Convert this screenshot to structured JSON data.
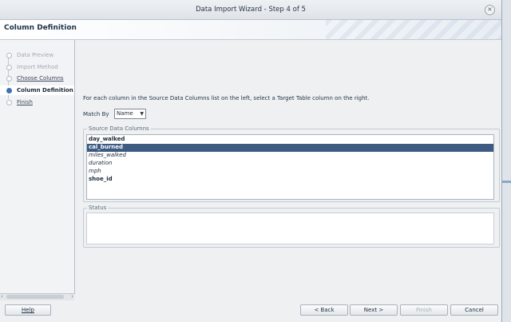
{
  "window": {
    "title": "Data Import Wizard - Step 4 of 5"
  },
  "header": {
    "title": "Column Definition"
  },
  "steps": [
    {
      "label": "Data Preview",
      "state": "disabled"
    },
    {
      "label": "Import Method",
      "state": "disabled"
    },
    {
      "label": "Choose Columns",
      "state": "link"
    },
    {
      "label": "Column Definition",
      "state": "current"
    },
    {
      "label": "Finish",
      "state": "link"
    }
  ],
  "instruction": "For each column in the Source Data Columns list on the left, select a Target Table column on the right.",
  "match_by": {
    "label": "Match By",
    "selected": "Name"
  },
  "source_columns": {
    "legend": "Source Data Columns",
    "items": [
      {
        "name": "day_walked",
        "style": "bold"
      },
      {
        "name": "cal_burned",
        "style": "bold",
        "selected": true
      },
      {
        "name": "miles_walked",
        "style": "italic"
      },
      {
        "name": "duration",
        "style": "italic"
      },
      {
        "name": "mph",
        "style": "italic"
      },
      {
        "name": "shoe_id",
        "style": "bold"
      }
    ]
  },
  "status": {
    "legend": "Status",
    "text": ""
  },
  "buttons": {
    "help": "Help",
    "back": "< Back",
    "next": "Next >",
    "finish": "Finish",
    "cancel": "Cancel"
  },
  "colors": {
    "selection": "#3c5a82",
    "current_step_dot": "#3b73b5",
    "window_bg": "#eef0f2"
  }
}
